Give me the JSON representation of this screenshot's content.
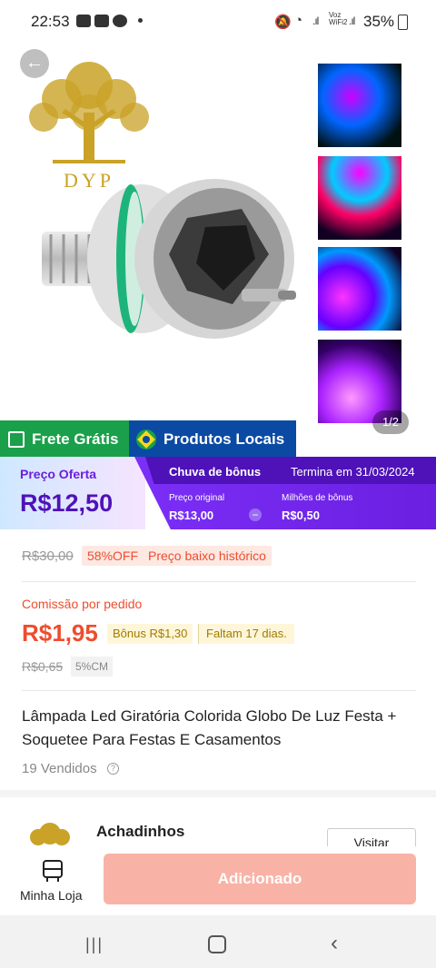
{
  "status_bar": {
    "time": "22:53",
    "battery": "35%",
    "network_label": "Voz WiFi2"
  },
  "product": {
    "page_indicator": "1/2",
    "logo_text": "DYP",
    "badges": {
      "free_shipping": "Frete Grátis",
      "local_products": "Produtos Locais"
    },
    "promo": {
      "offer_label": "Preço Oferta",
      "offer_price": "R$12,50",
      "bonus_title": "Chuva de bônus",
      "ends": "Termina em 31/03/2024",
      "original_label": "Preço original",
      "original_value": "R$13,00",
      "minus": "−",
      "bonus_label": "Milhões de bônus",
      "bonus_value": "R$0,50"
    },
    "old_price": "R$30,00",
    "discount": "58%OFF",
    "low_price_tag": "Preço baixo histórico",
    "commission_label": "Comissão por pedido",
    "commission_value": "R$1,95",
    "bonus_tag": "Bônus R$1,30",
    "remaining_tag": "Faltam 17 dias.",
    "old_commission": "R$0,65",
    "cm_rate": "5%CM",
    "title": "Lâmpada Led Giratória Colorida Globo De Luz Festa + Soquetee Para Festas E Casamentos",
    "sold": "19 Vendidos"
  },
  "store": {
    "name": "Achadinhos",
    "visit_label": "Visitar"
  },
  "bottom": {
    "my_store": "Minha Loja",
    "add_button": "Adicionado"
  },
  "colors": {
    "accent": "#ee4d2d",
    "free_shipping": "#1aa04a",
    "local": "#0b4aa3",
    "promo": "#6b1fe0"
  }
}
